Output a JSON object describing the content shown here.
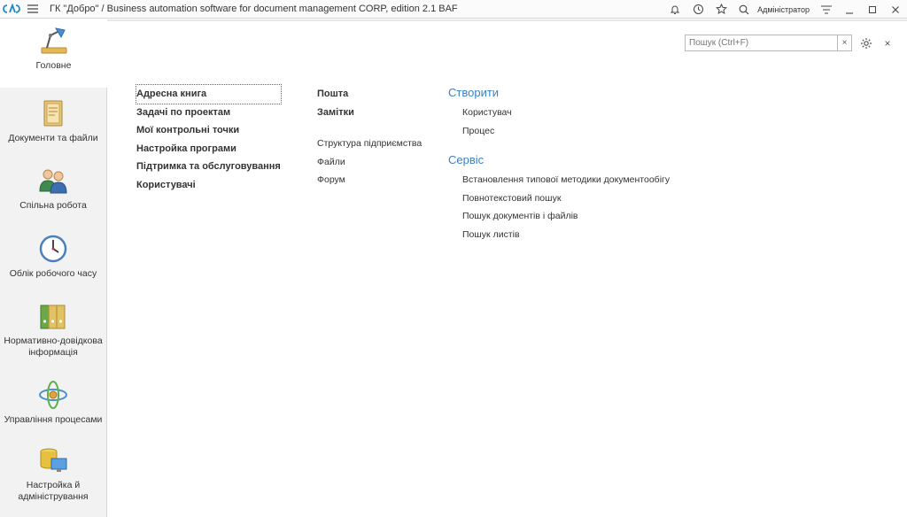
{
  "titlebar": {
    "title": "ГК \"Добро\" / Business automation software for document management CORP, edition 2.1 BAF",
    "user": "Адміністратор"
  },
  "sidebar": {
    "items": [
      {
        "label": "Головне",
        "icon": "desk-lamp-icon"
      },
      {
        "label": "Документи та файли",
        "icon": "folder-icon"
      },
      {
        "label": "Спільна робота",
        "icon": "people-icon"
      },
      {
        "label": "Облік робочого часу",
        "icon": "clock-icon"
      },
      {
        "label": "Нормативно-довідкова інформація",
        "icon": "binders-icon"
      },
      {
        "label": "Управління процесами",
        "icon": "process-icon"
      },
      {
        "label": "Настройка й адміністрування",
        "icon": "admin-icon"
      }
    ]
  },
  "search": {
    "placeholder": "Пошук (Ctrl+F)",
    "clear": "×"
  },
  "close_label": "×",
  "col1": [
    "Адресна книга",
    "Задачі по проектам",
    "Мої контрольні точки",
    "Настройка програми",
    "Підтримка та обслуговування",
    "Користувачі"
  ],
  "col2_bold": [
    "Пошта",
    "Замітки"
  ],
  "col2": [
    "Структура підприємства",
    "Файли",
    "Форум"
  ],
  "create": {
    "title": "Створити",
    "items": [
      "Користувач",
      "Процес"
    ]
  },
  "service": {
    "title": "Сервіс",
    "items": [
      "Встановлення типової методики документообігу",
      "Повнотекстовий пошук",
      "Пошук документів і файлів",
      "Пошук листів"
    ]
  },
  "colors": {
    "accent": "#3b7fc4",
    "logo": "#1e88c8"
  }
}
